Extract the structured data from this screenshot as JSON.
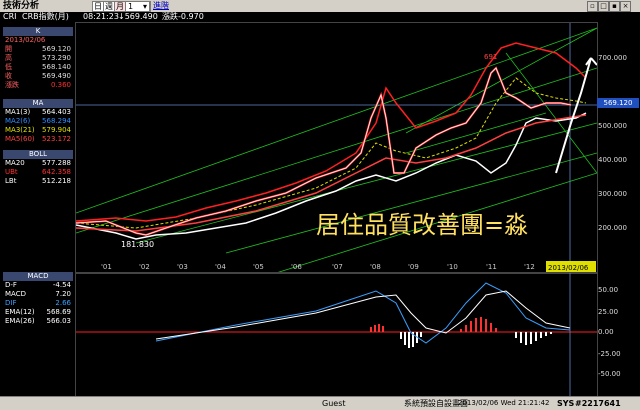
{
  "app_title": "技術分析",
  "toolbar": {
    "periods": [
      "日",
      "週",
      "月"
    ],
    "active_period": "月",
    "dropdown_value": "1",
    "link_label": "進階"
  },
  "info_bar": {
    "symbol": "CRI",
    "name": "CRB指數(月)",
    "time": "08:21:23",
    "last": "↓569.490",
    "change": "漲跌-0.970"
  },
  "quote_panel": {
    "header": "K",
    "date": "2013/02/06",
    "rows": [
      {
        "label": "開",
        "value": "569.120"
      },
      {
        "label": "高",
        "value": "573.290"
      },
      {
        "label": "低",
        "value": "568.140"
      },
      {
        "label": "收",
        "value": "569.490"
      },
      {
        "label": "漲跌",
        "value": "0.360"
      }
    ]
  },
  "ma_panel": {
    "header": "MA",
    "rows": [
      {
        "label": "MA1(3)",
        "value": "564.403",
        "color": "#ffffff"
      },
      {
        "label": "MA2(6)",
        "value": "568.294",
        "color": "#2d8cff"
      },
      {
        "label": "MA3(21)",
        "value": "579.904",
        "color": "#e0e000"
      },
      {
        "label": "MA5(60)",
        "value": "523.172",
        "color": "#ff4040"
      }
    ]
  },
  "boll_panel": {
    "header": "BOLL",
    "rows": [
      {
        "label": "MA20",
        "value": "577.288",
        "color": "#ffffff"
      },
      {
        "label": "UBt",
        "value": "642.358",
        "color": "#ff3030"
      },
      {
        "label": "LBt",
        "value": "512.218",
        "color": "#ffffff"
      }
    ]
  },
  "macd_panel": {
    "header": "MACD",
    "rows": [
      {
        "label": "D-F",
        "value": "-4.54",
        "color": "#ffffff"
      },
      {
        "label": "MACD",
        "value": "7.20",
        "color": "#ffffff"
      },
      {
        "label": "DIF",
        "value": "2.66",
        "color": "#3aa0ff"
      },
      {
        "label": "EMA(12)",
        "value": "568.69",
        "color": "#ffffff"
      },
      {
        "label": "EMA(26)",
        "value": "566.03",
        "color": "#ffffff"
      }
    ]
  },
  "main_chart": {
    "y_ticks": [
      "700.000",
      "600.000",
      "500.000",
      "400.000",
      "300.000",
      "200.000"
    ],
    "current_price_tag": "569.120",
    "x_ticks": [
      "'01",
      "'02",
      "'03",
      "'04",
      "'05",
      "'06",
      "'07",
      "'08",
      "'09",
      "'10",
      "'11",
      "'12"
    ],
    "date_tag": "2013/02/06",
    "low_label": "181.830",
    "high_label": "691",
    "watermark": "居住品質改善團=淼"
  },
  "macd_chart": {
    "y_ticks": [
      "50.00",
      "25.00",
      "0.00",
      "-25.00",
      "-50.00"
    ]
  },
  "status_bar": {
    "user": "Guest",
    "layout": "系統預設自設畫面",
    "datetime": "2013/02/06 Wed 21:21:42",
    "sys": "SYS",
    "post_id": "#2217641"
  },
  "colors": {
    "accent_red": "#ff2020",
    "grid_green": "#20c020",
    "ma_blue": "#2d8cff",
    "ma_yellow": "#e0e000"
  }
}
